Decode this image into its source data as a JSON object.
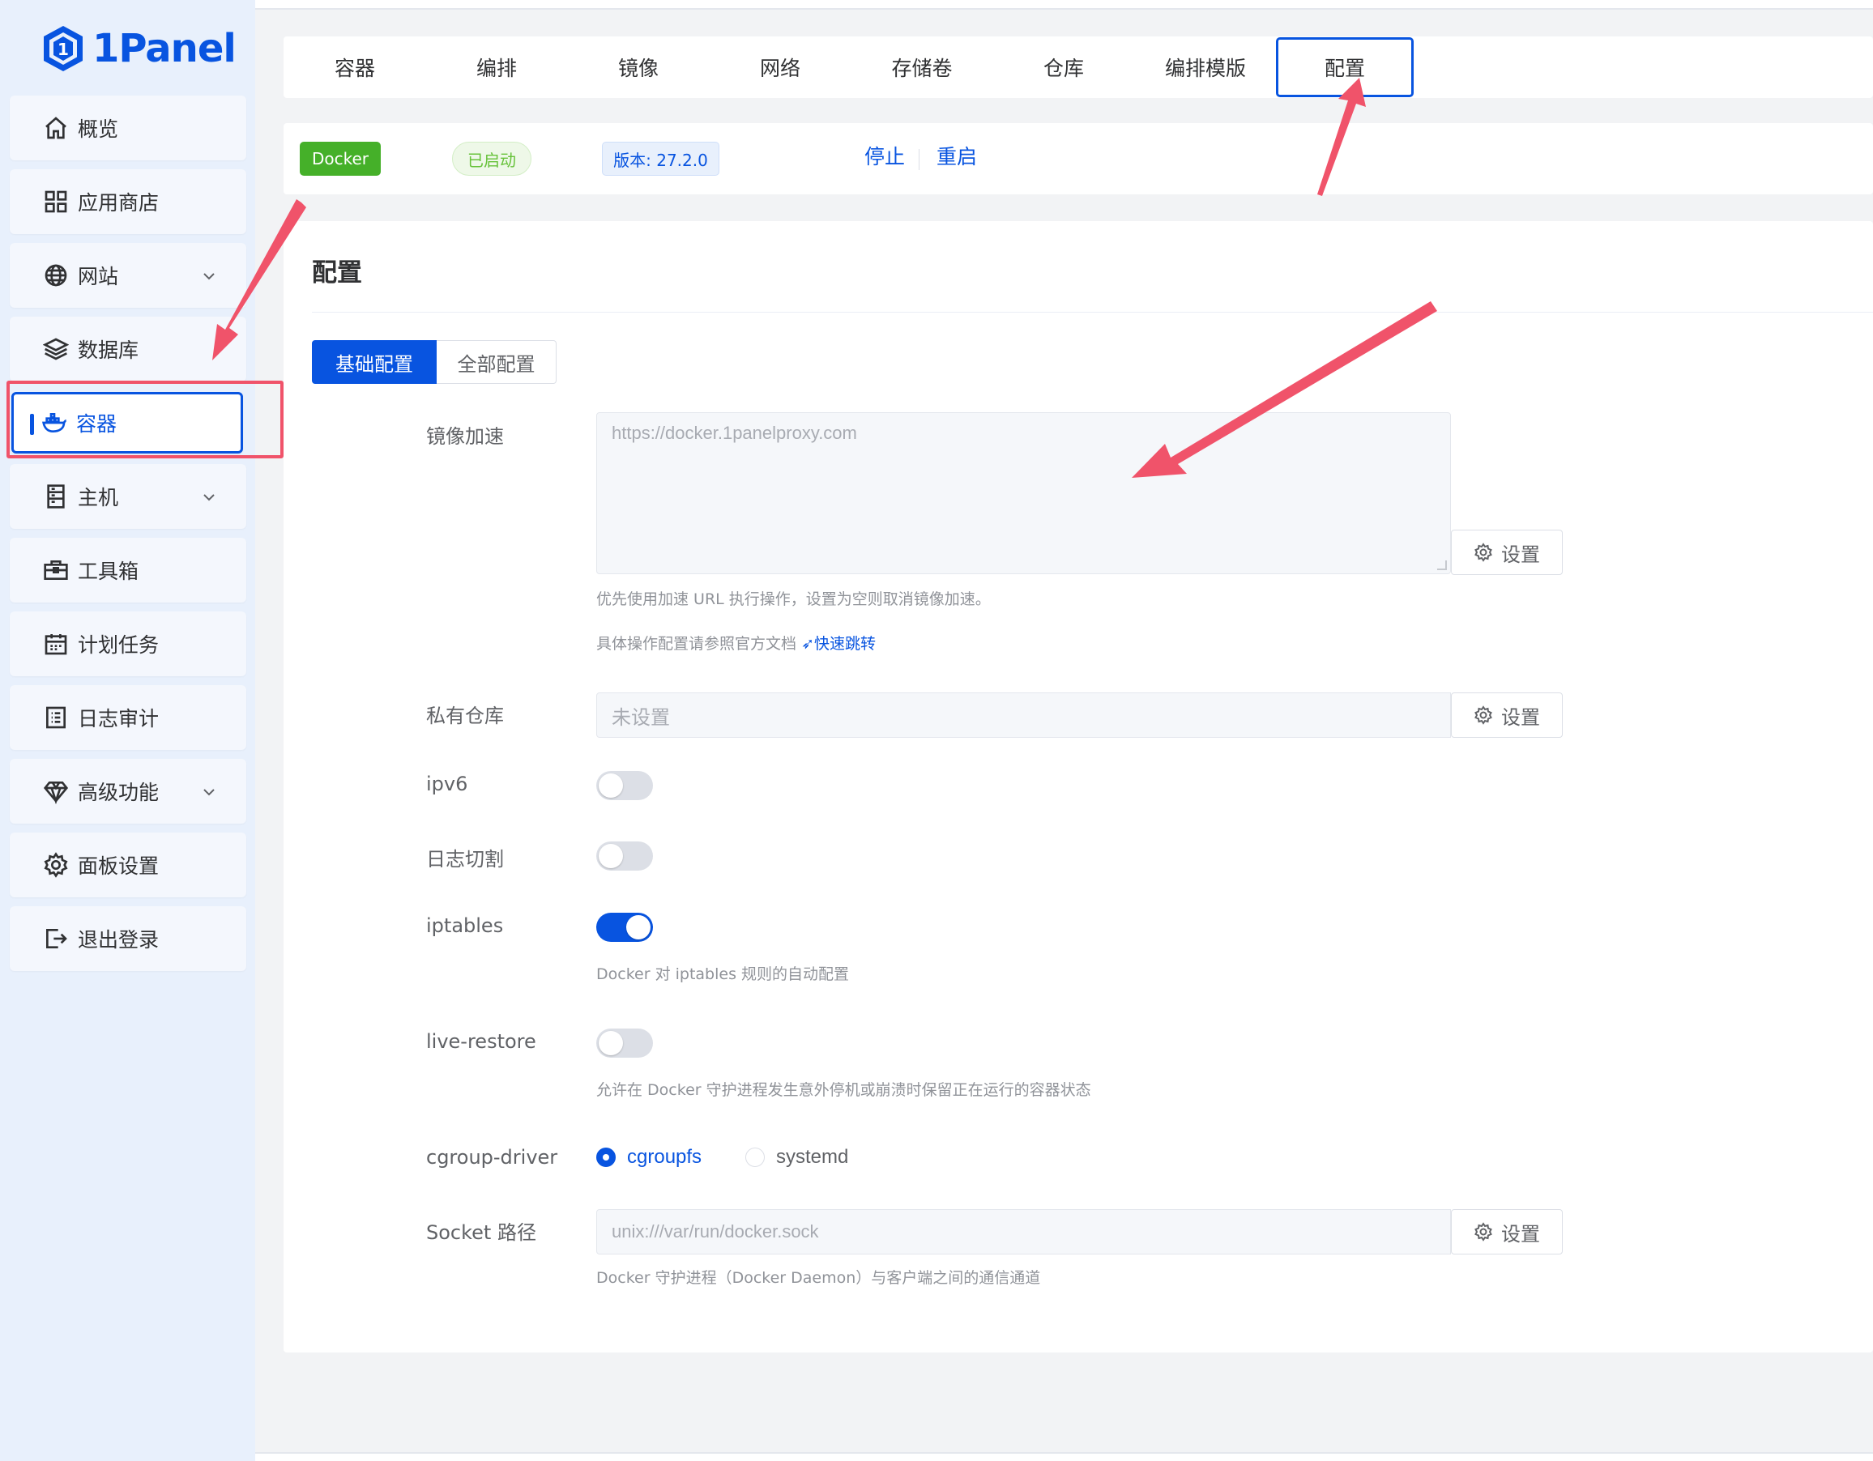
{
  "brand": {
    "name": "1Panel",
    "color": "#0854e0"
  },
  "sidebar": {
    "items": [
      {
        "label": "概览",
        "icon": "home-icon"
      },
      {
        "label": "应用商店",
        "icon": "grid-icon"
      },
      {
        "label": "网站",
        "icon": "globe-icon",
        "expandable": true
      },
      {
        "label": "数据库",
        "icon": "layers-icon"
      },
      {
        "label": "容器",
        "icon": "docker-icon",
        "active": true
      },
      {
        "label": "主机",
        "icon": "server-icon",
        "expandable": true
      },
      {
        "label": "工具箱",
        "icon": "toolbox-icon"
      },
      {
        "label": "计划任务",
        "icon": "calendar-icon"
      },
      {
        "label": "日志审计",
        "icon": "log-icon"
      },
      {
        "label": "高级功能",
        "icon": "diamond-icon",
        "expandable": true
      },
      {
        "label": "面板设置",
        "icon": "gear-icon"
      },
      {
        "label": "退出登录",
        "icon": "logout-icon"
      }
    ]
  },
  "tabs": {
    "items": [
      "容器",
      "编排",
      "镜像",
      "网络",
      "存储卷",
      "仓库",
      "编排模版",
      "配置"
    ],
    "active": "配置"
  },
  "status": {
    "name": "Docker",
    "state": "已启动",
    "version": "版本: 27.2.0",
    "stop": "停止",
    "restart": "重启",
    "colors": {
      "name_bg": "#45b029",
      "state_fg": "#67c23a"
    }
  },
  "panel": {
    "title": "配置",
    "subtabs": {
      "basic": "基础配置",
      "all": "全部配置"
    },
    "set_label": "设置",
    "mirror": {
      "label": "镜像加速",
      "value": "https://docker.1panelproxy.com",
      "hint": "优先使用加速 URL 执行操作，设置为空则取消镜像加速。",
      "doc_hint": "具体操作配置请参照官方文档",
      "doc_link": "快速跳转"
    },
    "registry": {
      "label": "私有仓库",
      "value": "未设置"
    },
    "ipv6": {
      "label": "ipv6",
      "enabled": false
    },
    "log_rotate": {
      "label": "日志切割",
      "enabled": false
    },
    "iptables": {
      "label": "iptables",
      "enabled": true,
      "hint": "Docker 对 iptables 规则的自动配置"
    },
    "live_restore": {
      "label": "live-restore",
      "enabled": false,
      "hint": "允许在 Docker 守护进程发生意外停机或崩溃时保留正在运行的容器状态"
    },
    "cgroup": {
      "label": "cgroup-driver",
      "options": [
        "cgroupfs",
        "systemd"
      ],
      "selected": "cgroupfs"
    },
    "socket": {
      "label": "Socket 路径",
      "value": "unix:///var/run/docker.sock",
      "hint": "Docker 守护进程（Docker Daemon）与客户端之间的通信通道"
    }
  },
  "annotation_color": "#f0536a"
}
